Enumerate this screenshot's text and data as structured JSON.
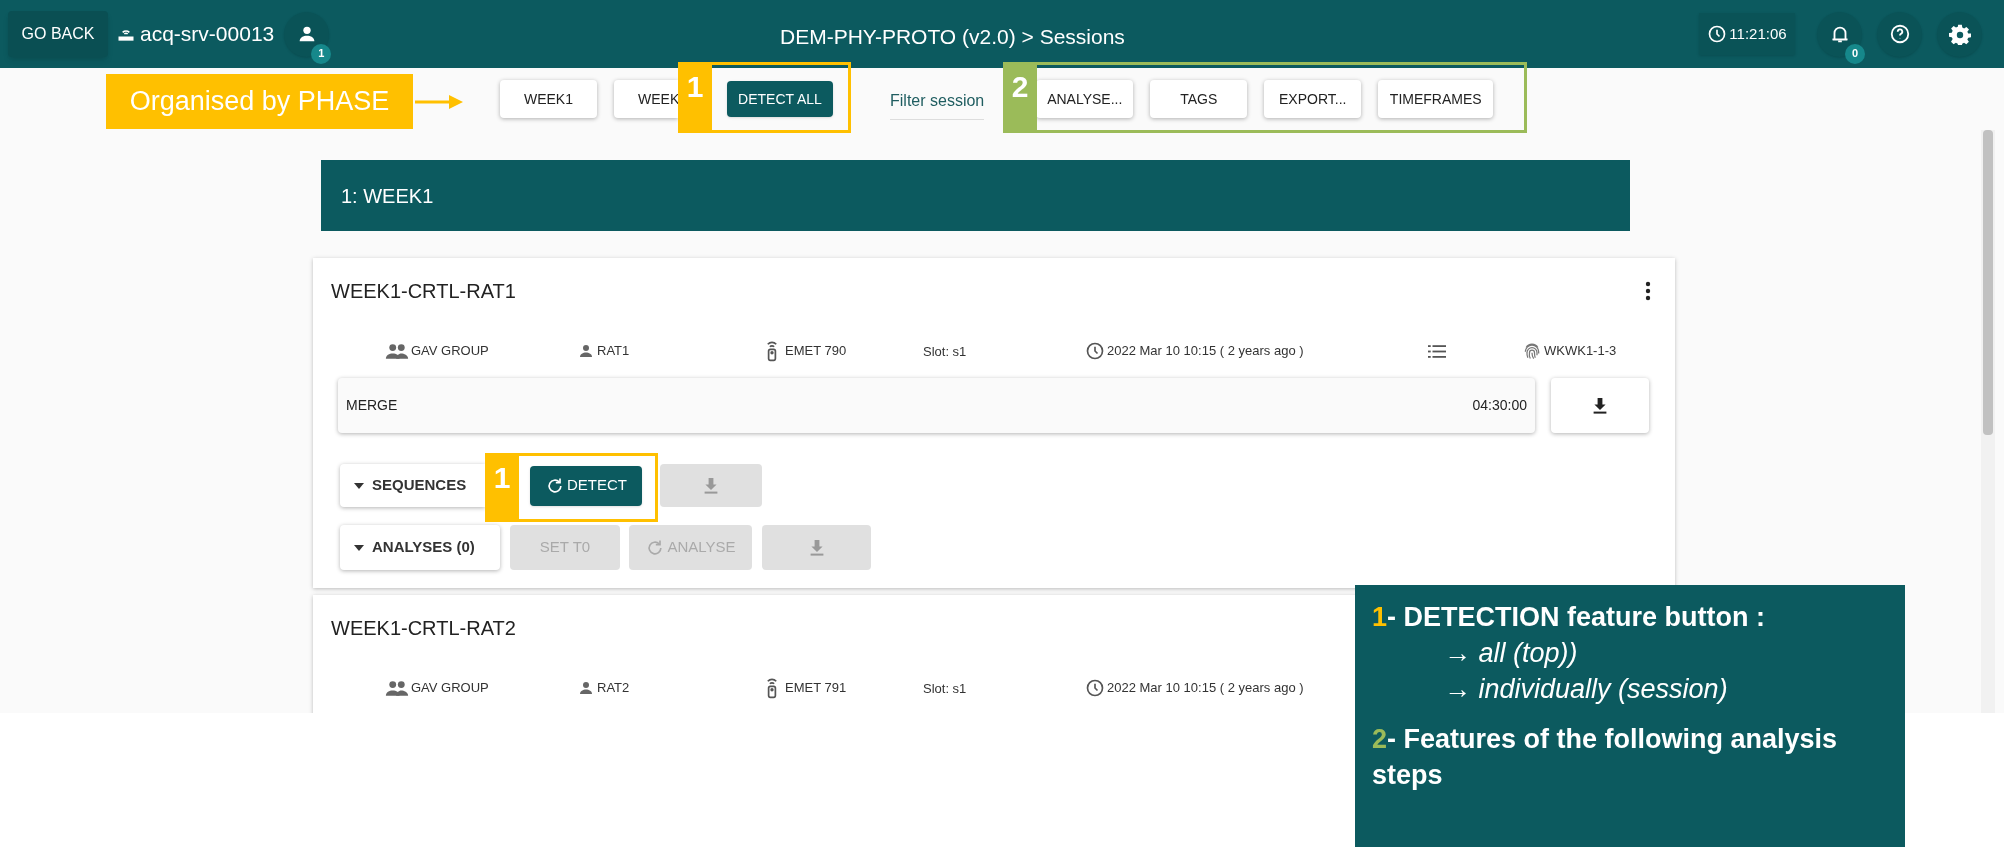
{
  "topbar": {
    "back_button": "GO BACK",
    "server": "acq-srv-00013",
    "user_badge": "1",
    "title": "DEM-PHY-PROTO (v2.0) > Sessions",
    "clock": "11:21:06",
    "notification_badge": "0"
  },
  "toolbar": {
    "phase_buttons": [
      "WEEK1",
      "WEEK"
    ],
    "detect_all": "DETECT ALL",
    "filter_label": "Filter session",
    "feature_buttons": [
      "ANALYSE...",
      "TAGS",
      "EXPORT...",
      "TIMEFRAMES"
    ]
  },
  "phase_header": "1: WEEK1",
  "sessions": [
    {
      "title": "WEEK1-CRTL-RAT1",
      "group": "GAV GROUP",
      "animal": "RAT1",
      "device": "EMET 790",
      "slot": "Slot: s1",
      "date": "2022 Mar 10 10:15 ( 2 years ago )",
      "tag": "WKWK1-1-3",
      "merge": {
        "label": "MERGE",
        "duration": "04:30:00"
      },
      "sequences": {
        "label": "SEQUENCES",
        "detect": "DETECT",
        "download_disabled": true
      },
      "analyses": {
        "label": "ANALYSES (0)",
        "set_t0": "SET T0",
        "analyse": "ANALYSE",
        "disabled": true
      }
    },
    {
      "title": "WEEK1-CRTL-RAT2",
      "group": "GAV GROUP",
      "animal": "RAT2",
      "device": "EMET 791",
      "slot": "Slot: s1",
      "date": "2022 Mar 10 10:15 ( 2 years ago )"
    }
  ],
  "annotations": {
    "phase_label": "Organised by PHASE",
    "markers": [
      {
        "number": "1",
        "color": "#ffc000"
      },
      {
        "number": "2",
        "color": "#9bbb59"
      },
      {
        "number": "1",
        "color": "#ffc000"
      }
    ],
    "callout": [
      {
        "number": "1",
        "color": "#ffc000",
        "text": "- DETECTION feature button  :",
        "lines": [
          "→ *all (top))*",
          "→ *individually (session)*"
        ]
      },
      {
        "number": "2",
        "color": "#9bbb59",
        "text": "- Features of the following analysis steps"
      }
    ]
  }
}
